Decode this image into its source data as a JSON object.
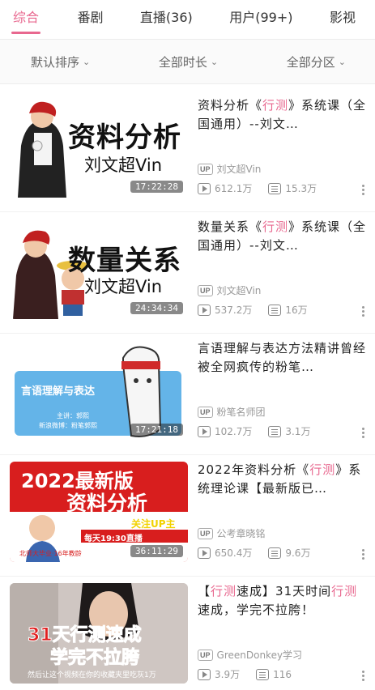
{
  "tabs": [
    {
      "label": "综合",
      "active": true
    },
    {
      "label": "番剧",
      "active": false
    },
    {
      "label": "直播(36)",
      "active": false
    },
    {
      "label": "用户(99+)",
      "active": false
    },
    {
      "label": "影视",
      "active": false
    }
  ],
  "filters": [
    {
      "label": "默认排序"
    },
    {
      "label": "全部时长"
    },
    {
      "label": "全部分区"
    }
  ],
  "colors": {
    "accent": "#e8688f",
    "text": "#222222",
    "muted": "#999999"
  },
  "videos": [
    {
      "title_parts": [
        {
          "text": "资料分析《",
          "hl": false
        },
        {
          "text": "行测",
          "hl": true
        },
        {
          "text": "》系统课（全国通用）--刘文…",
          "hl": false
        }
      ],
      "uploader": "刘文超Vin",
      "views": "612.1万",
      "danmaku": "15.3万",
      "duration": "17:22:28",
      "thumb_title": "资料分析",
      "thumb_sub": "刘文超Vin"
    },
    {
      "title_parts": [
        {
          "text": "数量关系《",
          "hl": false
        },
        {
          "text": "行测",
          "hl": true
        },
        {
          "text": "》系统课（全国通用）--刘文…",
          "hl": false
        }
      ],
      "uploader": "刘文超Vin",
      "views": "537.2万",
      "danmaku": "16万",
      "duration": "24:34:34",
      "thumb_title": "数量关系",
      "thumb_sub": "刘文超Vin"
    },
    {
      "title_parts": [
        {
          "text": "言语理解与表达方法精讲曾经被全网疯传的粉笔…",
          "hl": false
        }
      ],
      "uploader": "粉笔名师团",
      "views": "102.7万",
      "danmaku": "3.1万",
      "duration": "17:21:18",
      "thumb_title": "言语理解与表达",
      "thumb_sub": "主讲：郭熙",
      "thumb_sub2": "新浪微博：粉笔郭熙"
    },
    {
      "title_parts": [
        {
          "text": "2022年资料分析《",
          "hl": false
        },
        {
          "text": "行测",
          "hl": true
        },
        {
          "text": "》系统理论课【最新版已…",
          "hl": false
        }
      ],
      "uploader": "公考章晓铭",
      "views": "650.4万",
      "danmaku": "9.6万",
      "duration": "36:11:29",
      "thumb_title": "2022最新版",
      "thumb_title2": "资料分析",
      "thumb_badge": "关注UP主",
      "thumb_live": "每天19:30直播",
      "thumb_foot": "北师大毕业·16年教龄"
    },
    {
      "title_parts": [
        {
          "text": "【",
          "hl": false
        },
        {
          "text": "行测",
          "hl": true
        },
        {
          "text": "速成】31天时间",
          "hl": false
        },
        {
          "text": "行测",
          "hl": true
        },
        {
          "text": "速成，学完不拉胯！",
          "hl": false
        }
      ],
      "uploader": "GreenDonkey学习",
      "views": "3.9万",
      "danmaku": "116",
      "duration": "",
      "thumb_title": "31天行测速成",
      "thumb_title2": "学完不拉胯",
      "thumb_sub": "然后让这个视频在你的收藏夹里吃灰1万"
    }
  ]
}
